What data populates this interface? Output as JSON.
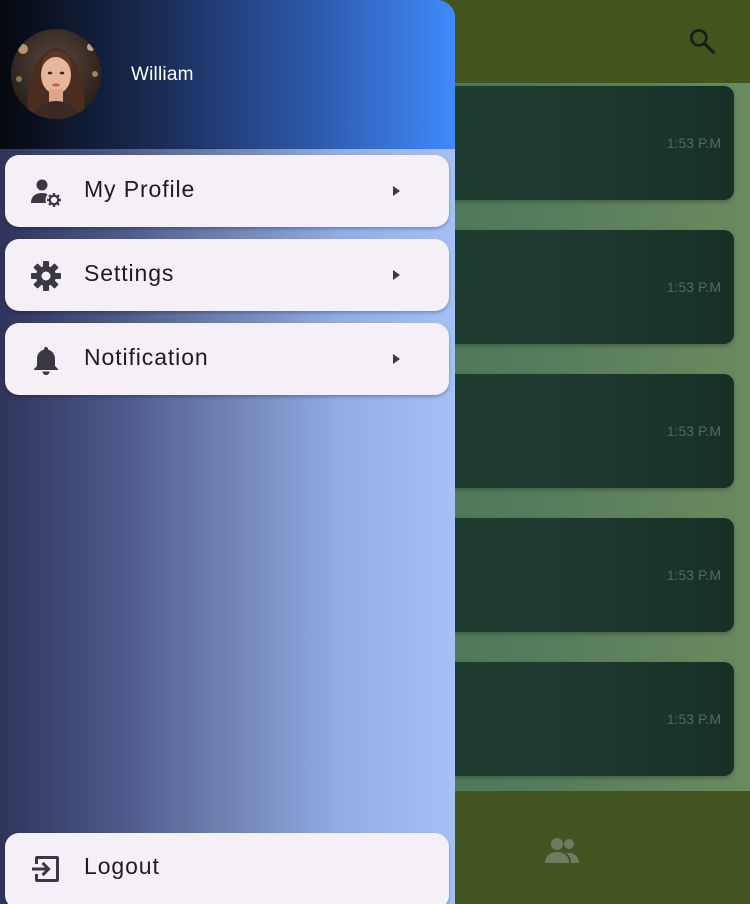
{
  "app": {
    "search_icon": "search-icon",
    "chats": [
      {
        "time": "1:53 P.M"
      },
      {
        "time": "1:53 P.M"
      },
      {
        "time": "1:53 P.M"
      },
      {
        "time": "1:53 P.M"
      },
      {
        "time": "1:53 P.M"
      }
    ],
    "bottom_nav_icon": "group-icon",
    "colors": {
      "app_bar": "#43551f",
      "card": "#1e3a2e"
    }
  },
  "drawer": {
    "user": {
      "name": "William",
      "avatar_icon": "avatar"
    },
    "items": [
      {
        "label": "My Profile",
        "icon": "manage-accounts-icon"
      },
      {
        "label": "Settings",
        "icon": "gear-icon"
      },
      {
        "label": "Notification",
        "icon": "bell-icon"
      }
    ],
    "logout": {
      "label": "Logout",
      "icon": "logout-icon"
    },
    "colors": {
      "header_start": "#05080f",
      "header_end": "#3f8bfa",
      "item_bg": "#f5eff7"
    }
  }
}
